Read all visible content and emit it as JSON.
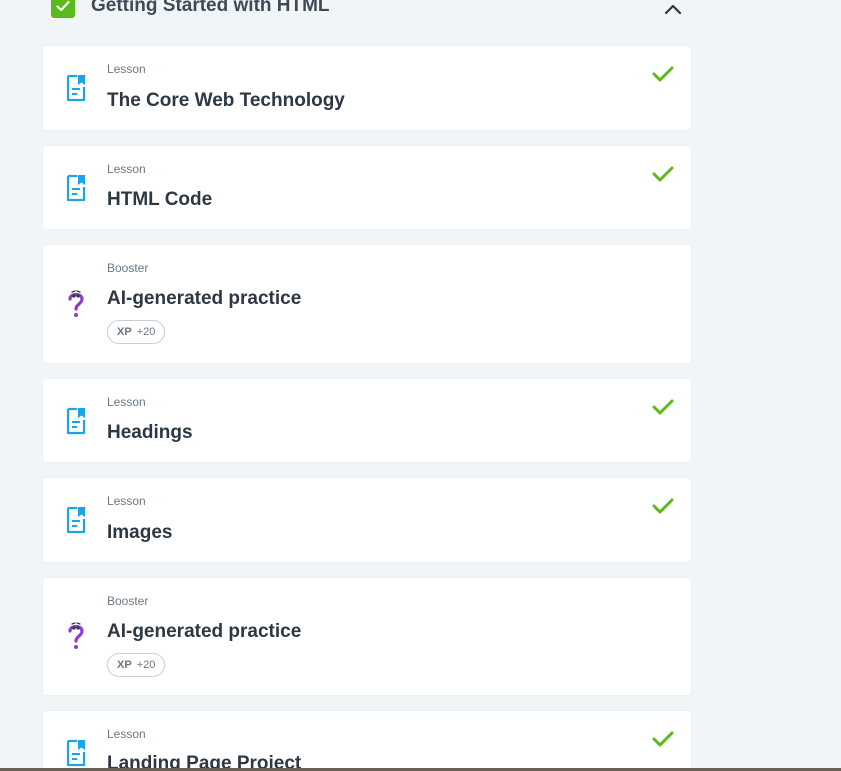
{
  "section": {
    "title": "Getting Started with HTML",
    "completed": true
  },
  "items": [
    {
      "type": "Lesson",
      "title": "The Core Web Technology",
      "kind": "lesson",
      "completed": true
    },
    {
      "type": "Lesson",
      "title": "HTML Code",
      "kind": "lesson",
      "completed": true
    },
    {
      "type": "Booster",
      "title": "AI-generated practice",
      "kind": "booster",
      "xp_label": "XP",
      "xp_value": "+20",
      "completed": false
    },
    {
      "type": "Lesson",
      "title": "Headings",
      "kind": "lesson",
      "completed": true
    },
    {
      "type": "Lesson",
      "title": "Images",
      "kind": "lesson",
      "completed": true
    },
    {
      "type": "Booster",
      "title": "AI-generated practice",
      "kind": "booster",
      "xp_label": "XP",
      "xp_value": "+20",
      "completed": false
    },
    {
      "type": "Lesson",
      "title": "Landing Page Project",
      "kind": "lesson",
      "completed": true
    }
  ],
  "colors": {
    "accent_green": "#5aba1b",
    "lesson_icon": "#1fa3e8",
    "booster_icon": "#8a3fd1",
    "page_bg": "#f2f5f7"
  },
  "icons": {
    "lesson": "lesson-doc-icon",
    "booster": "question-mark-icon",
    "done": "checkmark-icon",
    "collapse": "chevron-up-icon"
  }
}
